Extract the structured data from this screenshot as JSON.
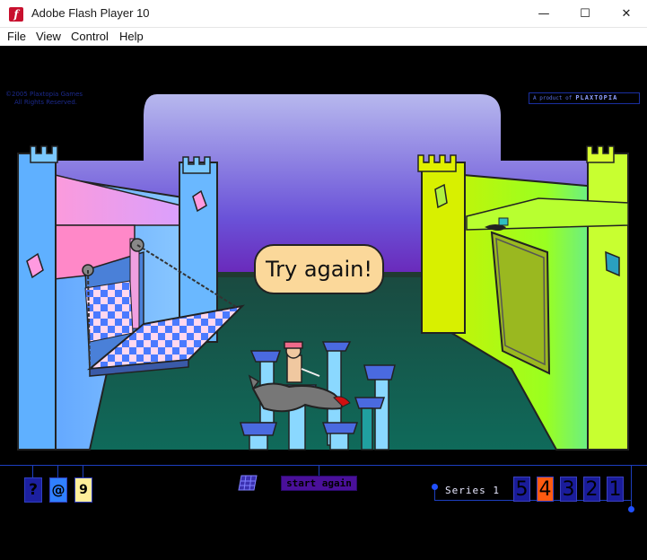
{
  "window": {
    "title": "Adobe Flash Player 10",
    "minimize_glyph": "—",
    "maximize_glyph": "☐",
    "close_glyph": "✕",
    "app_icon_glyph": "f"
  },
  "menu": {
    "items": [
      "File",
      "View",
      "Control",
      "Help"
    ]
  },
  "game": {
    "copyright_line1": "©2005 Plaxtopia Games",
    "copyright_line2": "All Rights Reserved.",
    "product_prefix": "A product of",
    "product_brand": "PLAXTOPIA",
    "speech_text": "Try again!",
    "help_glyph": "?",
    "email_glyph": "@",
    "about_glyph": "9",
    "start_again_label": "start again",
    "series_label": "Series 1",
    "levels": [
      {
        "label": "5",
        "state": "normal",
        "color": "#1a1c9a"
      },
      {
        "label": "4",
        "state": "current",
        "color": "#ff5a10"
      },
      {
        "label": "3",
        "state": "normal",
        "color": "#1a1c9a"
      },
      {
        "label": "2",
        "state": "normal",
        "color": "#1a1c9a"
      },
      {
        "label": "1",
        "state": "normal",
        "color": "#1a1c9a"
      }
    ]
  }
}
